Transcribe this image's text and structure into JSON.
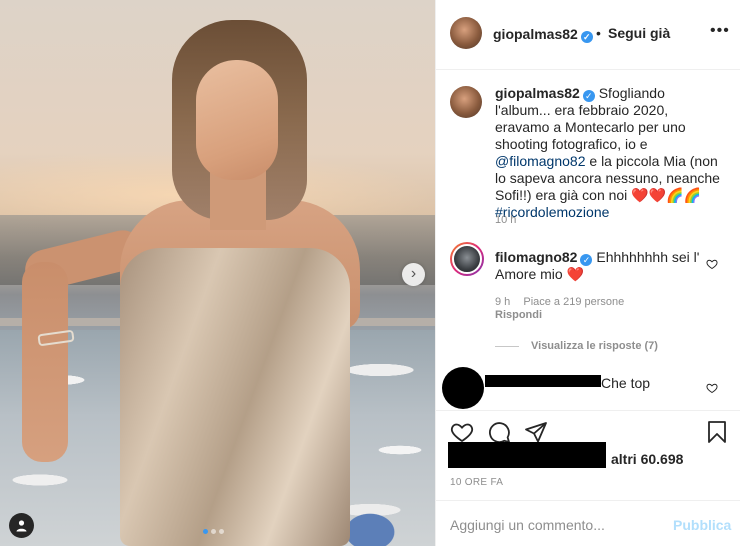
{
  "post": {
    "author": "giopalmas82",
    "separator": "•",
    "follow_label": "Segui già",
    "more_label": "•••"
  },
  "caption": {
    "author": "giopalmas82",
    "text_1": "Sfogliando l'album... era febbraio 2020, eravamo a Montecarlo per uno shooting fotografico, io e",
    "mention": "@filomagno82",
    "text_2": "e la piccola Mia (non lo sapeva ancora nessuno, neanche Sofi!!) era già con noi",
    "emoji": "❤️❤️🌈🌈",
    "hashtag": "#ricordolemozione",
    "time": "10 h"
  },
  "comment": {
    "author": "filomagno82",
    "text": "Ehhhhhhhh sei l' Amore mio",
    "emoji": "❤️",
    "time": "9 h",
    "likes": "Piace a 219 persone",
    "reply": "Rispondi"
  },
  "view_replies": "Visualizza le risposte (7)",
  "hidden_comment": {
    "text": "Che top"
  },
  "likes": {
    "text": "altri 60.698"
  },
  "date": "10 ORE FA",
  "comment_box": {
    "placeholder": "Aggiungi un commento...",
    "publish": "Pubblica"
  },
  "carousel": {
    "dots": 3,
    "active": 0,
    "next_arrow": "›"
  },
  "colors": {
    "accent": "#3897f0",
    "publish_disabled": "#b2dffc",
    "link": "#00376b",
    "like_heart": "#ed4956",
    "muted": "#8e8e8e"
  },
  "icons": [
    "verified-badge-icon",
    "heart-icon",
    "comment-icon",
    "share-icon",
    "bookmark-icon",
    "tag-user-icon",
    "chevron-right-icon"
  ]
}
